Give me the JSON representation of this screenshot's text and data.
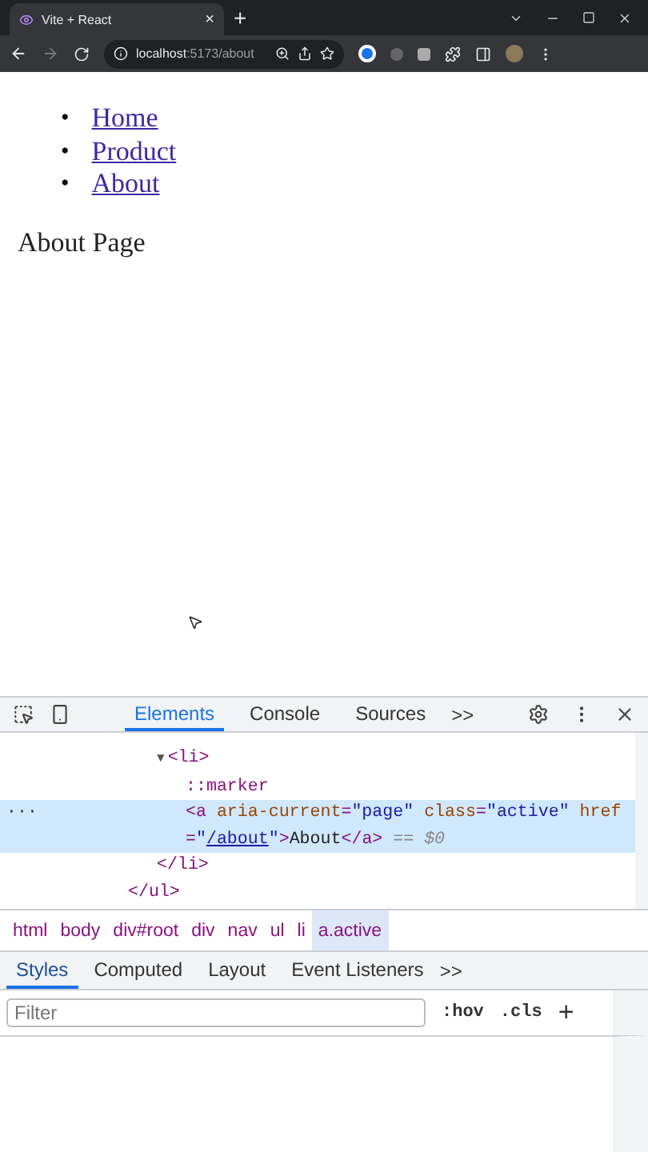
{
  "browser": {
    "tab": {
      "title": "Vite + React",
      "close": "×"
    },
    "new_tab": "+",
    "address": {
      "host": "localhost",
      "path": ":5173/about"
    }
  },
  "page": {
    "nav": [
      {
        "marker": "•",
        "label": "Home"
      },
      {
        "marker": "•",
        "label": "Product"
      },
      {
        "marker": "•",
        "label": "About"
      }
    ],
    "heading": "About Page"
  },
  "devtools": {
    "tabs": [
      {
        "label": "Elements",
        "selected": true
      },
      {
        "label": "Console",
        "selected": false
      },
      {
        "label": "Sources",
        "selected": false
      }
    ],
    "more": ">>",
    "dom": {
      "children": [
        {
          "selected": false,
          "tokens": [
            {
              "kind": "arrow",
              "text": "▼"
            },
            {
              "kind": "tag",
              "text": "<li>"
            }
          ],
          "children": [
            {
              "selected": false,
              "tokens": [
                {
                  "kind": "pseudo",
                  "text": "::marker"
                }
              ]
            },
            {
              "selected": true,
              "gutter": "···",
              "tokens": [
                {
                  "kind": "tag",
                  "text": "<a "
                },
                {
                  "kind": "attr",
                  "text": "aria-current"
                },
                {
                  "kind": "tag",
                  "text": "="
                },
                {
                  "kind": "value",
                  "text": "\"page\""
                },
                {
                  "kind": "attr",
                  "text": " class"
                },
                {
                  "kind": "tag",
                  "text": "="
                },
                {
                  "kind": "value",
                  "text": "\"active\""
                },
                {
                  "kind": "attr",
                  "text": " href"
                },
                {
                  "kind": "tag",
                  "text": "="
                },
                {
                  "kind": "value",
                  "text": "\""
                },
                {
                  "kind": "link",
                  "text": "/about"
                },
                {
                  "kind": "value",
                  "text": "\""
                },
                {
                  "kind": "tag",
                  "text": ">"
                },
                {
                  "kind": "text",
                  "text": "About"
                },
                {
                  "kind": "tag",
                  "text": "</a>"
                },
                {
                  "kind": "note",
                  "text": " == $0"
                }
              ]
            }
          ],
          "close": [
            {
              "kind": "tag",
              "text": "</li>"
            }
          ]
        }
      ],
      "close": [
        {
          "kind": "tag",
          "text": "</ul>"
        }
      ]
    },
    "breadcrumbs": [
      {
        "label": "html",
        "selected": false
      },
      {
        "label": "body",
        "selected": false
      },
      {
        "label": "div#root",
        "selected": false
      },
      {
        "label": "div",
        "selected": false
      },
      {
        "label": "nav",
        "selected": false
      },
      {
        "label": "ul",
        "selected": false
      },
      {
        "label": "li",
        "selected": false
      },
      {
        "label": "a.active",
        "selected": true
      }
    ],
    "style_tabs": [
      {
        "label": "Styles",
        "selected": true
      },
      {
        "label": "Computed",
        "selected": false
      },
      {
        "label": "Layout",
        "selected": false
      },
      {
        "label": "Event Listeners",
        "selected": false
      }
    ],
    "style_more": ">>",
    "filter": {
      "placeholder": "Filter"
    },
    "hov": ":hov",
    "cls": ".cls",
    "add": "+"
  }
}
